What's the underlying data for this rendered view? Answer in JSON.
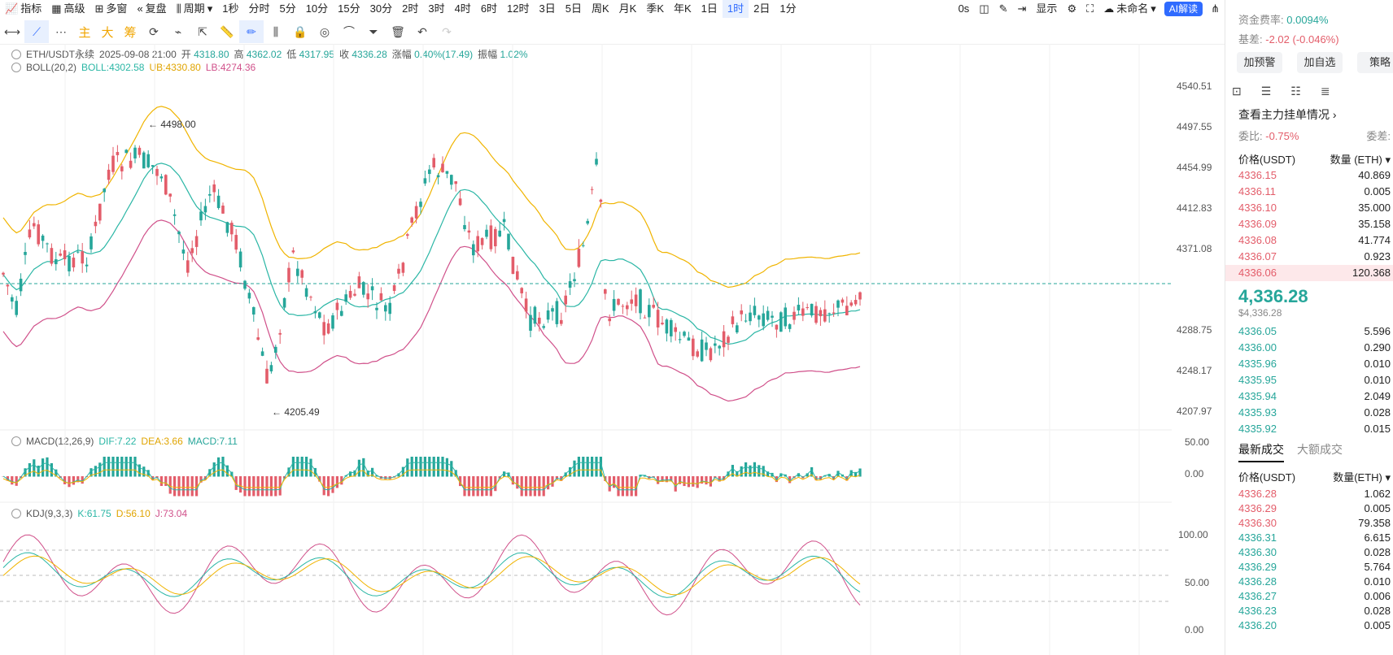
{
  "toolbar": {
    "items": [
      "指标",
      "高级",
      "多窗",
      "复盘",
      "周期",
      "1秒",
      "分时",
      "5分",
      "10分",
      "15分",
      "30分",
      "2时",
      "3时",
      "4时",
      "6时",
      "12时",
      "3日",
      "5日",
      "周K",
      "月K",
      "季K",
      "年K",
      "1日",
      "1时",
      "2日",
      "1分"
    ],
    "active": "1时",
    "right": [
      "0s",
      "显示",
      "未命名",
      "AI解读"
    ]
  },
  "draw_toolbar": {
    "zhu": "主",
    "da": "大",
    "chou": "筹"
  },
  "legend": {
    "main": {
      "symbol": "ETH/USDT永续",
      "datetime": "2025-09-08 21:00",
      "open_l": "开",
      "open": "4318.80",
      "high_l": "高",
      "high": "4362.02",
      "low_l": "低",
      "low": "4317.95",
      "close_l": "收",
      "close": "4336.28",
      "chg_l": "涨幅",
      "chg": "0.40%(17.49)",
      "amp_l": "振幅",
      "amp": "1.02%"
    },
    "boll": {
      "name": "BOLL(20,2)",
      "boll": "BOLL:4302.58",
      "ub": "UB:4330.80",
      "lb": "LB:4274.36"
    },
    "macd": {
      "name": "MACD(12,26,9)",
      "dif": "DIF:7.22",
      "dea": "DEA:3.66",
      "macd": "MACD:7.11"
    },
    "kdj": {
      "name": "KDJ(9,3,3)",
      "k": "K:61.75",
      "d": "D:56.10",
      "j": "J:73.04"
    }
  },
  "axis": {
    "price": [
      "4540.51",
      "4497.55",
      "4454.99",
      "4412.83",
      "4371.08",
      "4288.75",
      "4248.17",
      "4207.97"
    ],
    "current": "4336.28",
    "macd": [
      "50.00",
      "0.00"
    ],
    "kdj": [
      "100.00",
      "50.00",
      "0.00"
    ]
  },
  "annotations": {
    "high": "4498.00",
    "low": "4205.49"
  },
  "colors": {
    "up": "#26a69a",
    "down": "#e35d6a",
    "ub": "#f0b400",
    "mid": "#2ab6a5",
    "lb": "#d0508a",
    "accent": "#2f6bff"
  },
  "right_panel": {
    "funding_l": "资金费率:",
    "funding": "0.0094%",
    "basis_l": "基差:",
    "basis": "-2.02 (-0.046%)",
    "buttons": [
      "加预警",
      "加自选",
      "策略"
    ],
    "depth_title": "查看主力挂单情况",
    "weibi_l": "委比:",
    "weibi": "-0.75%",
    "weicha_l": "委差:",
    "book_head": [
      "价格(USDT)",
      "数量 (ETH)"
    ],
    "asks": [
      [
        "4336.15",
        "40.869"
      ],
      [
        "4336.11",
        "0.005"
      ],
      [
        "4336.10",
        "35.000"
      ],
      [
        "4336.09",
        "35.158"
      ],
      [
        "4336.08",
        "41.774"
      ],
      [
        "4336.07",
        "0.923"
      ],
      [
        "4336.06",
        "120.368"
      ]
    ],
    "last": "4,336.28",
    "last_sub": "$4,336.28",
    "bids": [
      [
        "4336.05",
        "5.596"
      ],
      [
        "4336.00",
        "0.290"
      ],
      [
        "4335.96",
        "0.010"
      ],
      [
        "4335.95",
        "0.010"
      ],
      [
        "4335.94",
        "2.049"
      ],
      [
        "4335.93",
        "0.028"
      ],
      [
        "4335.92",
        "0.015"
      ]
    ],
    "tabs": [
      "最新成交",
      "大额成交"
    ],
    "trade_head": [
      "价格(USDT)",
      "数量(ETH)"
    ],
    "trades": [
      [
        "4336.28",
        "1.062",
        "d"
      ],
      [
        "4336.29",
        "0.005",
        "d"
      ],
      [
        "4336.30",
        "79.358",
        "d"
      ],
      [
        "4336.31",
        "6.615",
        "u"
      ],
      [
        "4336.30",
        "0.028",
        "u"
      ],
      [
        "4336.29",
        "5.764",
        "u"
      ],
      [
        "4336.28",
        "0.010",
        "u"
      ],
      [
        "4336.27",
        "0.006",
        "u"
      ],
      [
        "4336.23",
        "0.028",
        "u"
      ],
      [
        "4336.20",
        "0.005",
        "u"
      ]
    ]
  }
}
